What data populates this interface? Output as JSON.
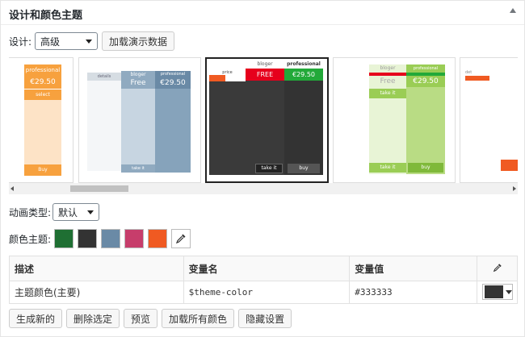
{
  "panel": {
    "title": "设计和颜色主题"
  },
  "design": {
    "label": "设计:",
    "selected": "高级",
    "load_demo": "加载演示数据"
  },
  "thumbnails": [
    {
      "head": "professional",
      "price": "€29.50",
      "btn": "select",
      "foot": "Buy"
    },
    {
      "col1": "details",
      "col2": "bloger",
      "col2_price": "Free",
      "col3": "professional",
      "col3_price": "€29.50",
      "foot": "take it"
    },
    {
      "top_label": "price",
      "col2": "bloger",
      "col2_price": "FREE",
      "col3": "professional",
      "col3_price": "€29.50",
      "foot1": "take it",
      "foot2": "buy"
    },
    {
      "col2": "bloger",
      "col2_price": "Free",
      "col3": "professional",
      "col3_price": "€29.50",
      "foot1": "take it",
      "foot2": "buy"
    },
    {
      "top_label": "det"
    }
  ],
  "animation": {
    "label": "动画类型:",
    "selected": "默认"
  },
  "colors": {
    "label": "颜色主题:",
    "swatches": [
      "#1f6f33",
      "#333333",
      "#6a8aa6",
      "#c73d6b",
      "#f05a22"
    ],
    "accent": "#f7a13e"
  },
  "vars_table": {
    "headers": [
      "描述",
      "变量名",
      "变量值"
    ],
    "rows": [
      {
        "desc": "主题颜色(主要)",
        "name": "$theme-color",
        "value": "#333333",
        "color": "#333333"
      }
    ]
  },
  "actions": [
    "生成新的",
    "删除选定",
    "预览",
    "加载所有颜色",
    "隐藏设置"
  ]
}
